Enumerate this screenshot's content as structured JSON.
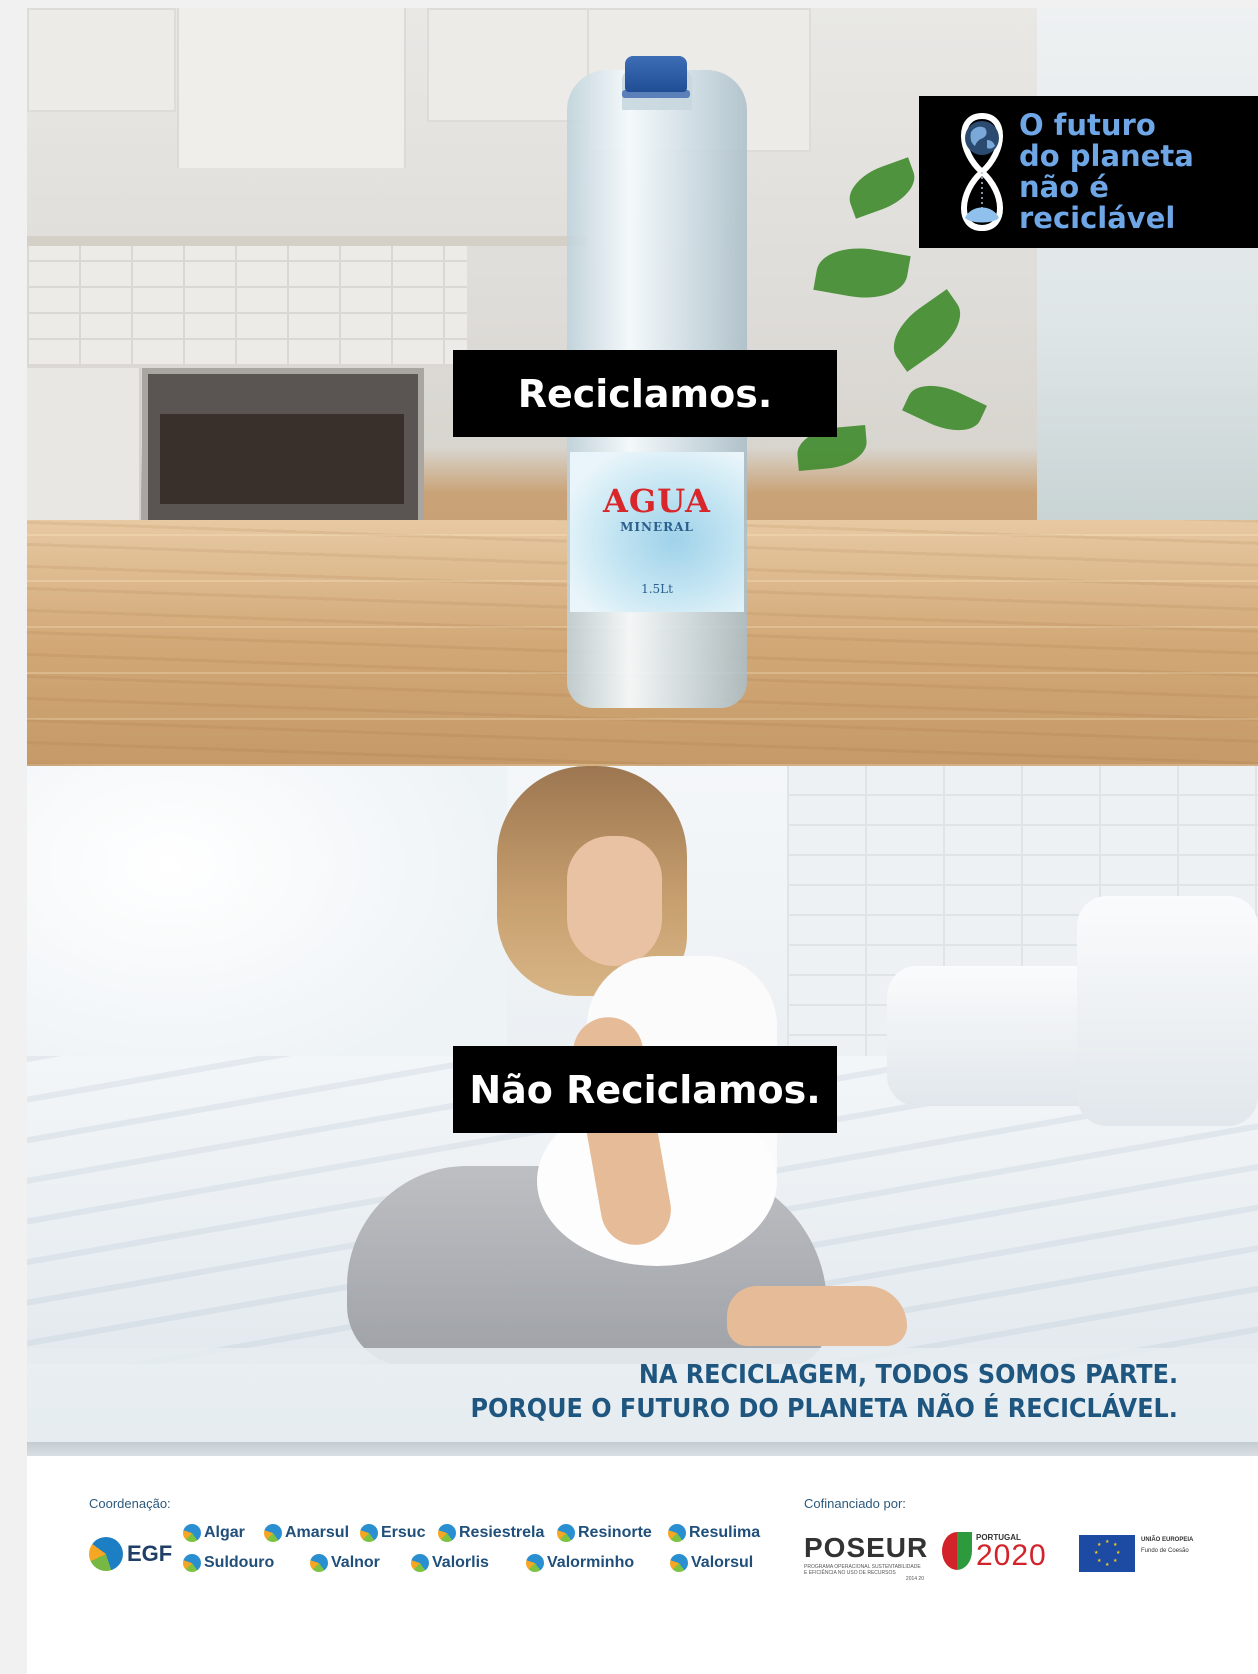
{
  "logo": {
    "lines": [
      "O futuro",
      "do planeta",
      "não é",
      "reciclável"
    ]
  },
  "bottle": {
    "brand": "AGUA",
    "type": "MINERAL",
    "volume": "1.5Lt"
  },
  "panels": {
    "top_tagline": "Reciclamos.",
    "bottom_tagline": "Não Reciclamos."
  },
  "slogan": {
    "line1": "NA RECICLAGEM, TODOS SOMOS PARTE.",
    "line2": "PORQUE O FUTURO DO PLANETA NÃO É RECICLÁVEL."
  },
  "footer": {
    "coordination_label": "Coordenação:",
    "coordinator": "EGF",
    "partners_row1": [
      "Algar",
      "Amarsul",
      "Ersuc",
      "Resiestrela",
      "Resinorte",
      "Resulima"
    ],
    "partners_row2": [
      "Suldouro",
      "Valnor",
      "Valorlis",
      "Valorminho",
      "Valorsul"
    ],
    "cofinance_label": "Cofinanciado por:",
    "poseur": {
      "name": "POSEUR",
      "subtitle": "PROGRAMA OPERACIONAL SUSTENTABILIDADE E EFICIÊNCIA NO USO DE RECURSOS",
      "years": "2014 20"
    },
    "portugal2020": {
      "small": "PORTUGAL",
      "big": "2020"
    },
    "eu": {
      "title": "UNIÃO EUROPEIA",
      "fund": "Fundo de Coesão"
    }
  },
  "colors": {
    "slogan_blue": "#1e5680",
    "logo_blue": "#6fa6e6",
    "box_black": "#000000"
  }
}
